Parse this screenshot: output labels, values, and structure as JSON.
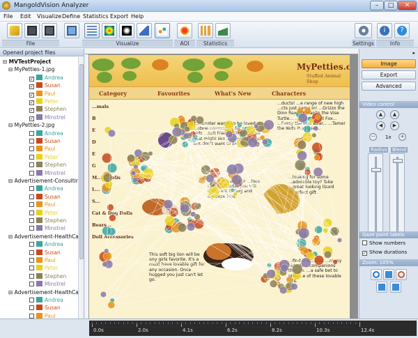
{
  "window": {
    "title": "MangoldVision Analyzer",
    "minimize": "–",
    "maximize": "□",
    "close": "✕"
  },
  "menu": [
    "File",
    "Edit",
    "Visualize",
    "Define",
    "Statistics",
    "Export",
    "Help"
  ],
  "toolbar": {
    "groups": {
      "file": "File",
      "visualize": "Visualize",
      "aoi": "AOI",
      "statistics": "Statistics",
      "settings": "Settings",
      "info": "Info"
    }
  },
  "left_panel": {
    "header": "Opened project files",
    "project": "MVTestProject",
    "images": [
      {
        "name": "MyPetties-1.jpg",
        "checked": true
      },
      {
        "name": "MyPetties-2.jpg",
        "checked": false
      },
      {
        "name": "Advertisement-Consulting",
        "checked": false
      },
      {
        "name": "Advertisement-HealthCar",
        "checked": false
      },
      {
        "name": "Advertisement-HealthCar",
        "checked": false
      }
    ],
    "participants": [
      {
        "name": "Andrea",
        "color": "#3aa6a0"
      },
      {
        "name": "Susan",
        "color": "#c7491c"
      },
      {
        "name": "Paul",
        "color": "#e8941a"
      },
      {
        "name": "Peter",
        "color": "#e9d21c"
      },
      {
        "name": "Stephen",
        "color": "#8c8158"
      },
      {
        "name": "Minstrel",
        "color": "#8a7aa8"
      }
    ]
  },
  "stimulus": {
    "brand": "MyPetties.com",
    "brand_sub": "Stuffed Animal Shop",
    "nav": [
      "Category",
      "Favourites",
      "What's New",
      "Characters"
    ],
    "text_top": "...monster wants to be loved. ...ideal companion for small kids ...soft friend with big fears that might like ...something soft but don't want to be ...d pussy.",
    "text_mid": "...ure ring a smile ...face. Leo is so cute, you will just want to hug and squeeze him.",
    "text_bottom": "This soft big lion will be any girls favorite. It's a must have lovable gift for any occasion. Once hugged you just can't let go.",
    "text_right_top": "...ducts! ...e range of new high ...cts just came in! ...Grizzo the Dino Rex... ...Maplin the Vise Turtle... ...s the Smart Fox... ...Fossy the Soft Bear... ...Tamer the Nuts Professor...",
    "text_right_mid": "...looking for some ...adorable toy? Take ...great looking lizard ...perfect gift.",
    "text_right_bottom": "...find the ...itive ...many kids do ...companions though. ...a safe bet to pick ...e of these lovable ...ls.",
    "left_labels": [
      "...mals",
      "B",
      "E",
      "D",
      "E",
      "G",
      "M...ls Dolls",
      "L...",
      "S...",
      "Cat & Dog Dolls",
      "Bears...",
      "Doll Accessories"
    ]
  },
  "right_panel": {
    "image_button": "Image",
    "export_button": "Export",
    "advanced_button": "Advanced",
    "video_control": "Video control",
    "speed": "1x",
    "radius_label": "Radius",
    "blend_label": "Blend",
    "radius_level": 0.85,
    "blend_level": 0.97,
    "gaze_labels": "Gaze point labels",
    "show_numbers": "Show numbers",
    "show_durations": "Show durations",
    "show_numbers_checked": false,
    "show_durations_checked": true,
    "zoom": "Zoom: 105%"
  },
  "timeline": {
    "ticks": [
      "0.0s",
      "2.0s",
      "4.1s",
      "6.2s",
      "8.2s",
      "10.3s",
      "12.4s"
    ]
  }
}
